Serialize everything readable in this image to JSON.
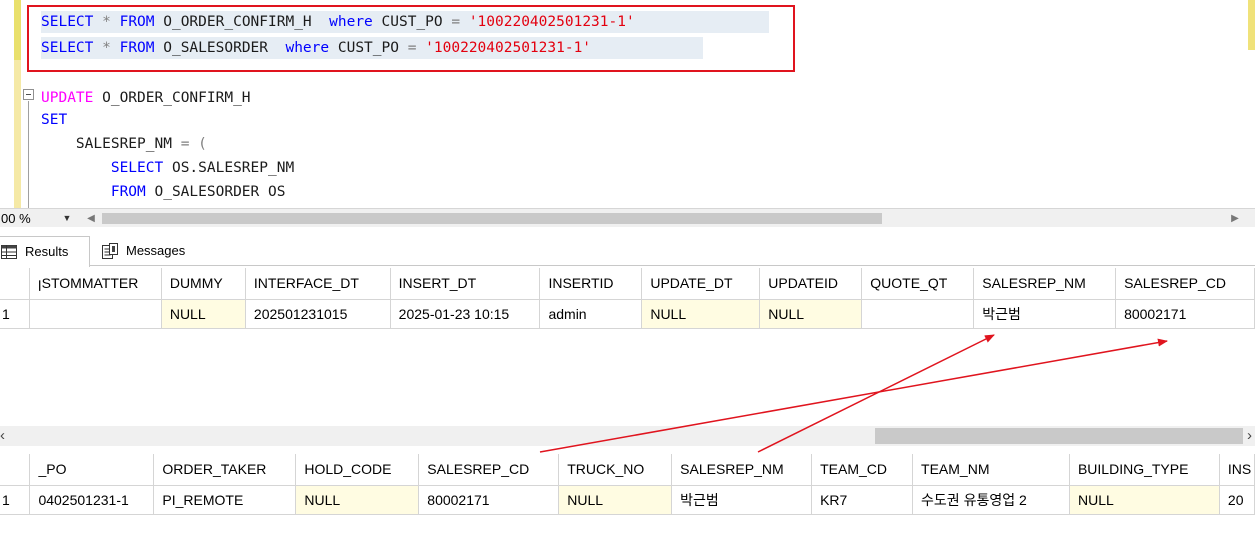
{
  "editor": {
    "lines": [
      {
        "tokens": [
          [
            "kw",
            "SELECT"
          ],
          [
            "op",
            " * "
          ],
          [
            "kw",
            "FROM"
          ],
          [
            "id",
            " O_ORDER_CONFIRM_H  "
          ],
          [
            "kw",
            "where"
          ],
          [
            "id",
            " CUST_PO "
          ],
          [
            "op",
            "="
          ],
          [
            "id",
            " "
          ],
          [
            "str",
            "'100220402501231-1'"
          ]
        ]
      },
      {
        "tokens": [
          [
            "kw",
            "SELECT"
          ],
          [
            "op",
            " * "
          ],
          [
            "kw",
            "FROM"
          ],
          [
            "id",
            " O_SALESORDER  "
          ],
          [
            "kw",
            "where"
          ],
          [
            "id",
            " CUST_PO "
          ],
          [
            "op",
            "="
          ],
          [
            "id",
            " "
          ],
          [
            "str",
            "'100220402501231-1'"
          ]
        ]
      },
      {
        "tokens": [
          [
            "kwp",
            "UPDATE"
          ],
          [
            "id",
            " O_ORDER_CONFIRM_H"
          ]
        ]
      },
      {
        "tokens": [
          [
            "kw",
            "SET"
          ]
        ]
      },
      {
        "tokens": [
          [
            "id",
            "    SALESREP_NM "
          ],
          [
            "op",
            "= ("
          ]
        ]
      },
      {
        "tokens": [
          [
            "id",
            "        "
          ],
          [
            "kw",
            "SELECT"
          ],
          [
            "id",
            " OS.SALESREP_NM"
          ]
        ]
      },
      {
        "tokens": [
          [
            "id",
            "        "
          ],
          [
            "kw",
            "FROM"
          ],
          [
            "id",
            " O_SALESORDER OS"
          ]
        ]
      }
    ]
  },
  "zoom": {
    "value": "00 %"
  },
  "tabs": {
    "results": "Results",
    "messages": "Messages"
  },
  "grid1": {
    "columns": [
      "",
      "ꞁSTOMMATTER",
      "DUMMY",
      "INTERFACE_DT",
      "INSERT_DT",
      "INSERTID",
      "UPDATE_DT",
      "UPDATEID",
      "QUOTE_QT",
      "SALESREP_NM",
      "SALESREP_CD"
    ],
    "rows": [
      [
        "1",
        "",
        "NULL",
        "202501231015",
        "2025-01-23 10:15",
        "admin",
        "NULL",
        "NULL",
        "",
        "박근범",
        "80002171"
      ]
    ],
    "null_cols": [
      2,
      6,
      7
    ]
  },
  "grid2": {
    "columns": [
      "",
      "_PO",
      "ORDER_TAKER",
      "HOLD_CODE",
      "SALESREP_CD",
      "TRUCK_NO",
      "SALESREP_NM",
      "TEAM_CD",
      "TEAM_NM",
      "BUILDING_TYPE",
      "INS"
    ],
    "rows": [
      [
        "1",
        "0402501231-1",
        "PI_REMOTE",
        "NULL",
        "80002171",
        "NULL",
        "박근범",
        "KR7",
        "수도권 유통영업 2",
        "NULL",
        "20"
      ]
    ],
    "null_cols": [
      3,
      5,
      9
    ]
  },
  "colors": {
    "annotation": "#e0141e",
    "keyword": "#0000ff",
    "string": "#e3000f",
    "null_bg": "#fffce2"
  }
}
